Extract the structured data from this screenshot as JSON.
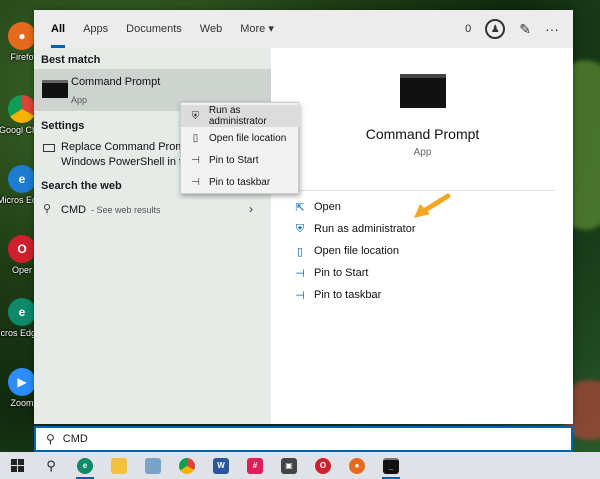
{
  "tabs": {
    "items": [
      "All",
      "Apps",
      "Documents",
      "Web",
      "More ▾"
    ],
    "points": "0"
  },
  "left": {
    "best_match_header": "Best match",
    "best_match_title": "Command Prompt",
    "best_match_sub": "App",
    "settings_header": "Settings",
    "settings_line1": "Replace Command Promp",
    "settings_line2": "Windows PowerShell in the",
    "web_header": "Search the web",
    "web_query": "CMD",
    "web_suffix": "- See web results"
  },
  "right": {
    "app_title": "Command Prompt",
    "app_sub": "App",
    "actions": [
      "Open",
      "Run as administrator",
      "Open file location",
      "Pin to Start",
      "Pin to taskbar"
    ]
  },
  "context_menu": [
    "Run as administrator",
    "Open file location",
    "Pin to Start",
    "Pin to taskbar"
  ],
  "search": {
    "value": "CMD"
  },
  "desktop_icons": [
    "Firefo",
    "Googl Chro",
    "Micros Edge",
    "Oper",
    "Micros Edge ca",
    "Zoom"
  ],
  "colors": {
    "accent": "#0063b1",
    "arrow": "#f5a623"
  }
}
